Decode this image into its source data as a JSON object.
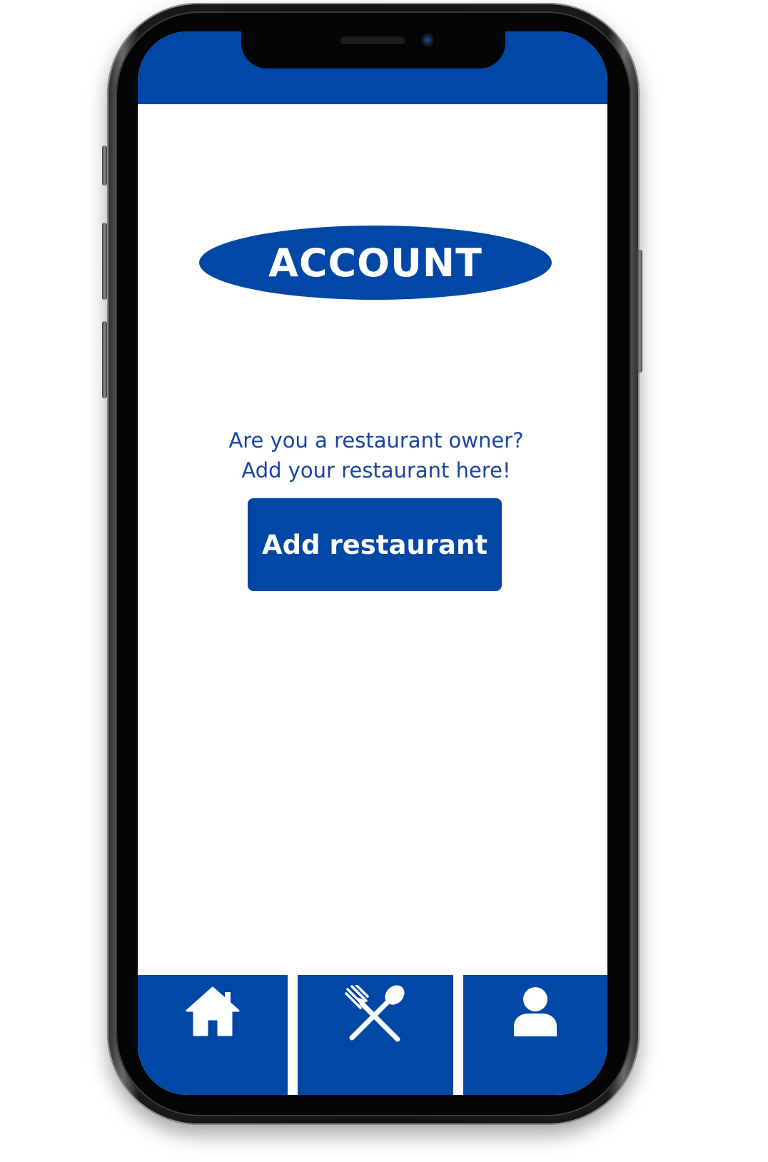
{
  "colors": {
    "brand_blue": "#0047a6",
    "text_blue": "#1a44a3",
    "background": "#ffffff",
    "phone_frame": "#111111"
  },
  "header": {
    "title": "ACCOUNT"
  },
  "main": {
    "prompt_line_1": "Are you a restaurant owner?",
    "prompt_line_2": "Add your restaurant here!",
    "add_button_label": "Add restaurant"
  },
  "bottom_nav": {
    "items": [
      {
        "icon": "home-icon"
      },
      {
        "icon": "fork-spoon-icon"
      },
      {
        "icon": "user-icon"
      }
    ]
  }
}
